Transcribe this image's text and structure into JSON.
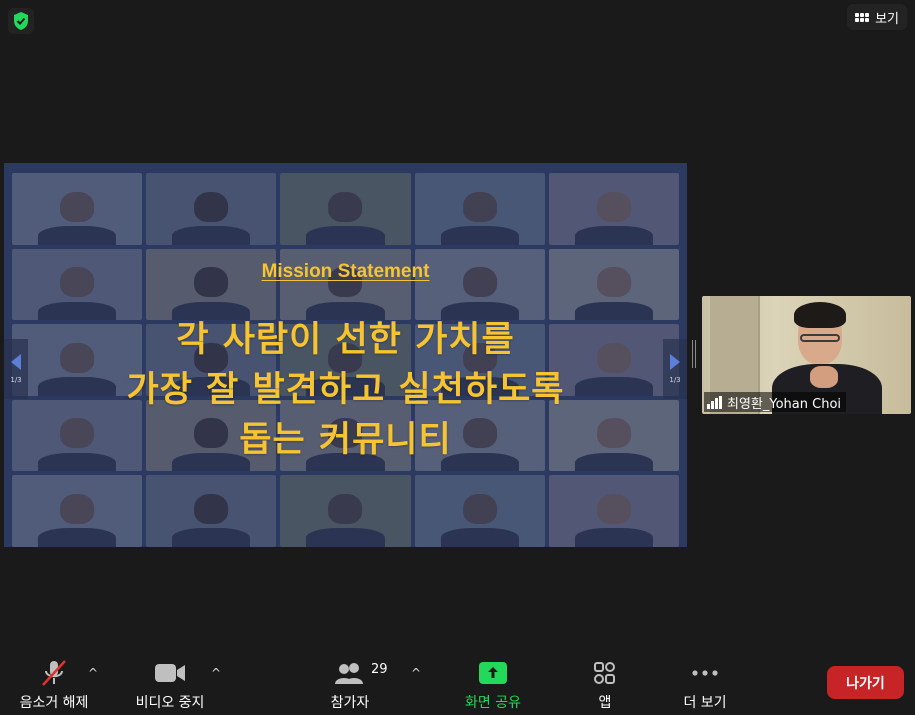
{
  "top_bar": {
    "security_icon": "shield-check-icon",
    "view_label": "보기"
  },
  "shared_screen": {
    "heading": "Mission Statement",
    "lines": [
      "각 사람이 선한 가치를",
      "가장 잘 발견하고 실천하도록",
      "돕는 커뮤니티"
    ],
    "page_indicator": "1/3",
    "accent_color": "#f6c431"
  },
  "self_view": {
    "name": "최영환_Yohan Choi"
  },
  "toolbar": {
    "mute_label": "음소거 해제",
    "video_label": "비디오 중지",
    "participants_label": "참가자",
    "participants_count": "29",
    "share_label": "화면 공유",
    "apps_label": "앱",
    "more_label": "더 보기",
    "leave_label": "나가기",
    "share_color": "#23d959",
    "leave_color": "#c72427"
  }
}
